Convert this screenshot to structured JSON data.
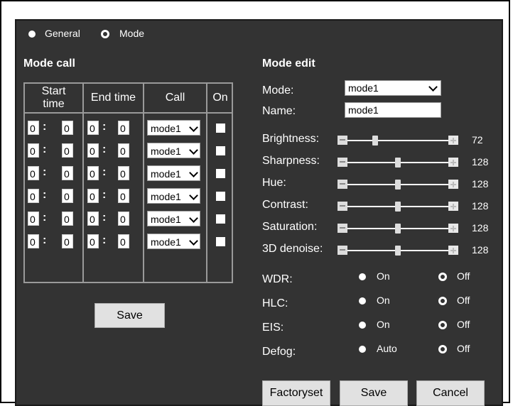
{
  "tabs": {
    "general_label": "General",
    "mode_label": "Mode",
    "selected": "Mode"
  },
  "mode_call": {
    "title": "Mode call",
    "headers": {
      "start_line1": "Start",
      "start_line2": "time",
      "end": "End time",
      "call": "Call",
      "on": "On"
    },
    "rows": [
      {
        "start_h": "0",
        "start_m": "0",
        "end_h": "0",
        "end_m": "0",
        "call": "mode1",
        "on": false
      },
      {
        "start_h": "0",
        "start_m": "0",
        "end_h": "0",
        "end_m": "0",
        "call": "mode1",
        "on": false
      },
      {
        "start_h": "0",
        "start_m": "0",
        "end_h": "0",
        "end_m": "0",
        "call": "mode1",
        "on": false
      },
      {
        "start_h": "0",
        "start_m": "0",
        "end_h": "0",
        "end_m": "0",
        "call": "mode1",
        "on": false
      },
      {
        "start_h": "0",
        "start_m": "0",
        "end_h": "0",
        "end_m": "0",
        "call": "mode1",
        "on": false
      },
      {
        "start_h": "0",
        "start_m": "0",
        "end_h": "0",
        "end_m": "0",
        "call": "mode1",
        "on": false
      }
    ],
    "save_label": "Save"
  },
  "mode_edit": {
    "title": "Mode edit",
    "mode_label": "Mode:",
    "mode_value": "mode1",
    "name_label": "Name:",
    "name_value": "mode1",
    "sliders": [
      {
        "label": "Brightness:",
        "value": "72",
        "fraction": 0.28
      },
      {
        "label": "Sharpness:",
        "value": "128",
        "fraction": 0.5
      },
      {
        "label": "Hue:",
        "value": "128",
        "fraction": 0.5
      },
      {
        "label": "Contrast:",
        "value": "128",
        "fraction": 0.5
      },
      {
        "label": "Saturation:",
        "value": "128",
        "fraction": 0.5
      },
      {
        "label": "3D denoise:",
        "value": "128",
        "fraction": 0.5
      }
    ],
    "toggles": [
      {
        "label": "WDR:",
        "opt1": "On",
        "opt2": "Off",
        "selected": "Off"
      },
      {
        "label": "HLC:",
        "opt1": "On",
        "opt2": "Off",
        "selected": "Off"
      },
      {
        "label": "EIS:",
        "opt1": "On",
        "opt2": "Off",
        "selected": "Off"
      },
      {
        "label": "Defog:",
        "opt1": "Auto",
        "opt2": "Off",
        "selected": "Off"
      }
    ],
    "buttons": {
      "factoryset": "Factoryset",
      "save": "Save",
      "cancel": "Cancel"
    }
  },
  "colors": {
    "panel_bg": "#333333",
    "table_border": "#9a9a9a",
    "button_bg": "#e1e1e1"
  }
}
